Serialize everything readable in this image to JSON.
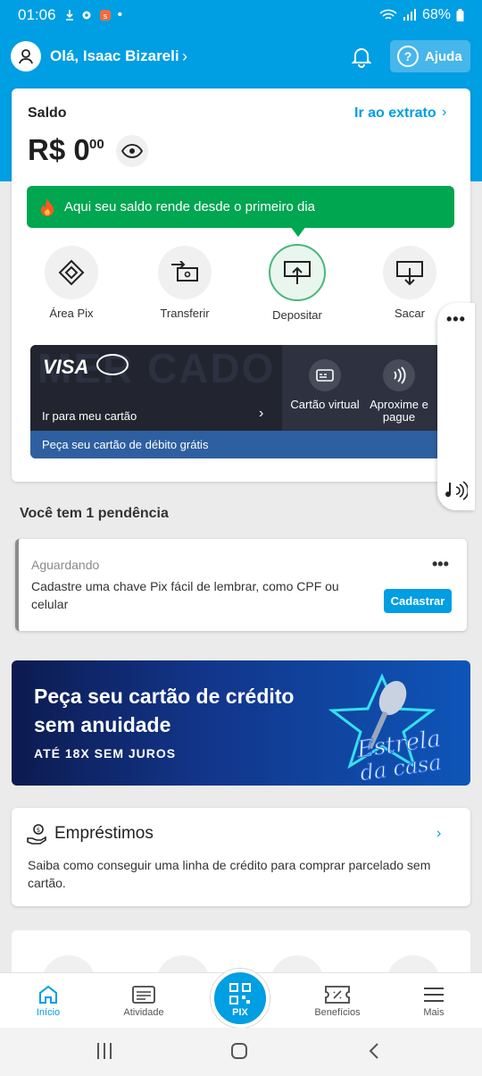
{
  "status_bar": {
    "time": "01:06",
    "battery": "68%"
  },
  "header": {
    "greeting": "Olá, Isaac Bizareli",
    "help_label": "Ajuda"
  },
  "balance": {
    "title": "Saldo",
    "extrato_link": "Ir ao extrato",
    "amount": "R$ 0",
    "cents": "00",
    "promo_text": "Aqui seu saldo rende desde o primeiro dia"
  },
  "actions": [
    {
      "label": "Área Pix",
      "icon": "pix-icon"
    },
    {
      "label": "Transferir",
      "icon": "transfer-icon"
    },
    {
      "label": "Depositar",
      "icon": "deposit-icon"
    },
    {
      "label": "Sacar",
      "icon": "withdraw-icon"
    }
  ],
  "card": {
    "brand": "VISA",
    "link": "Ir para meu cartão",
    "watermark": "MER CADO",
    "virtual_label": "Cartão virtual",
    "contactless_label": "Aproxime e pague",
    "footer": "Peça seu cartão de débito grátis"
  },
  "pending": {
    "title": "Você tem 1 pendência",
    "status": "Aguardando",
    "text": "Cadastre uma chave Pix fácil de lembrar, como CPF ou celular",
    "button": "Cadastrar"
  },
  "promo_banner": {
    "title": "Peça seu cartão de crédito sem anuidade",
    "subtitle": "ATÉ 18X SEM JUROS",
    "art_text_1": "Estrela",
    "art_text_2": "da casa"
  },
  "loans": {
    "title": "Empréstimos",
    "text": "Saiba como conseguir uma linha de crédito para comprar parcelado sem cartão."
  },
  "bottom_nav": {
    "home": "Início",
    "activity": "Atividade",
    "pix": "PIX",
    "benefits": "Benefícios",
    "more": "Mais"
  },
  "colors": {
    "primary": "#009ee3",
    "success": "#00a650",
    "card_dark": "#22252f",
    "card_footer": "#2e5fa0"
  }
}
